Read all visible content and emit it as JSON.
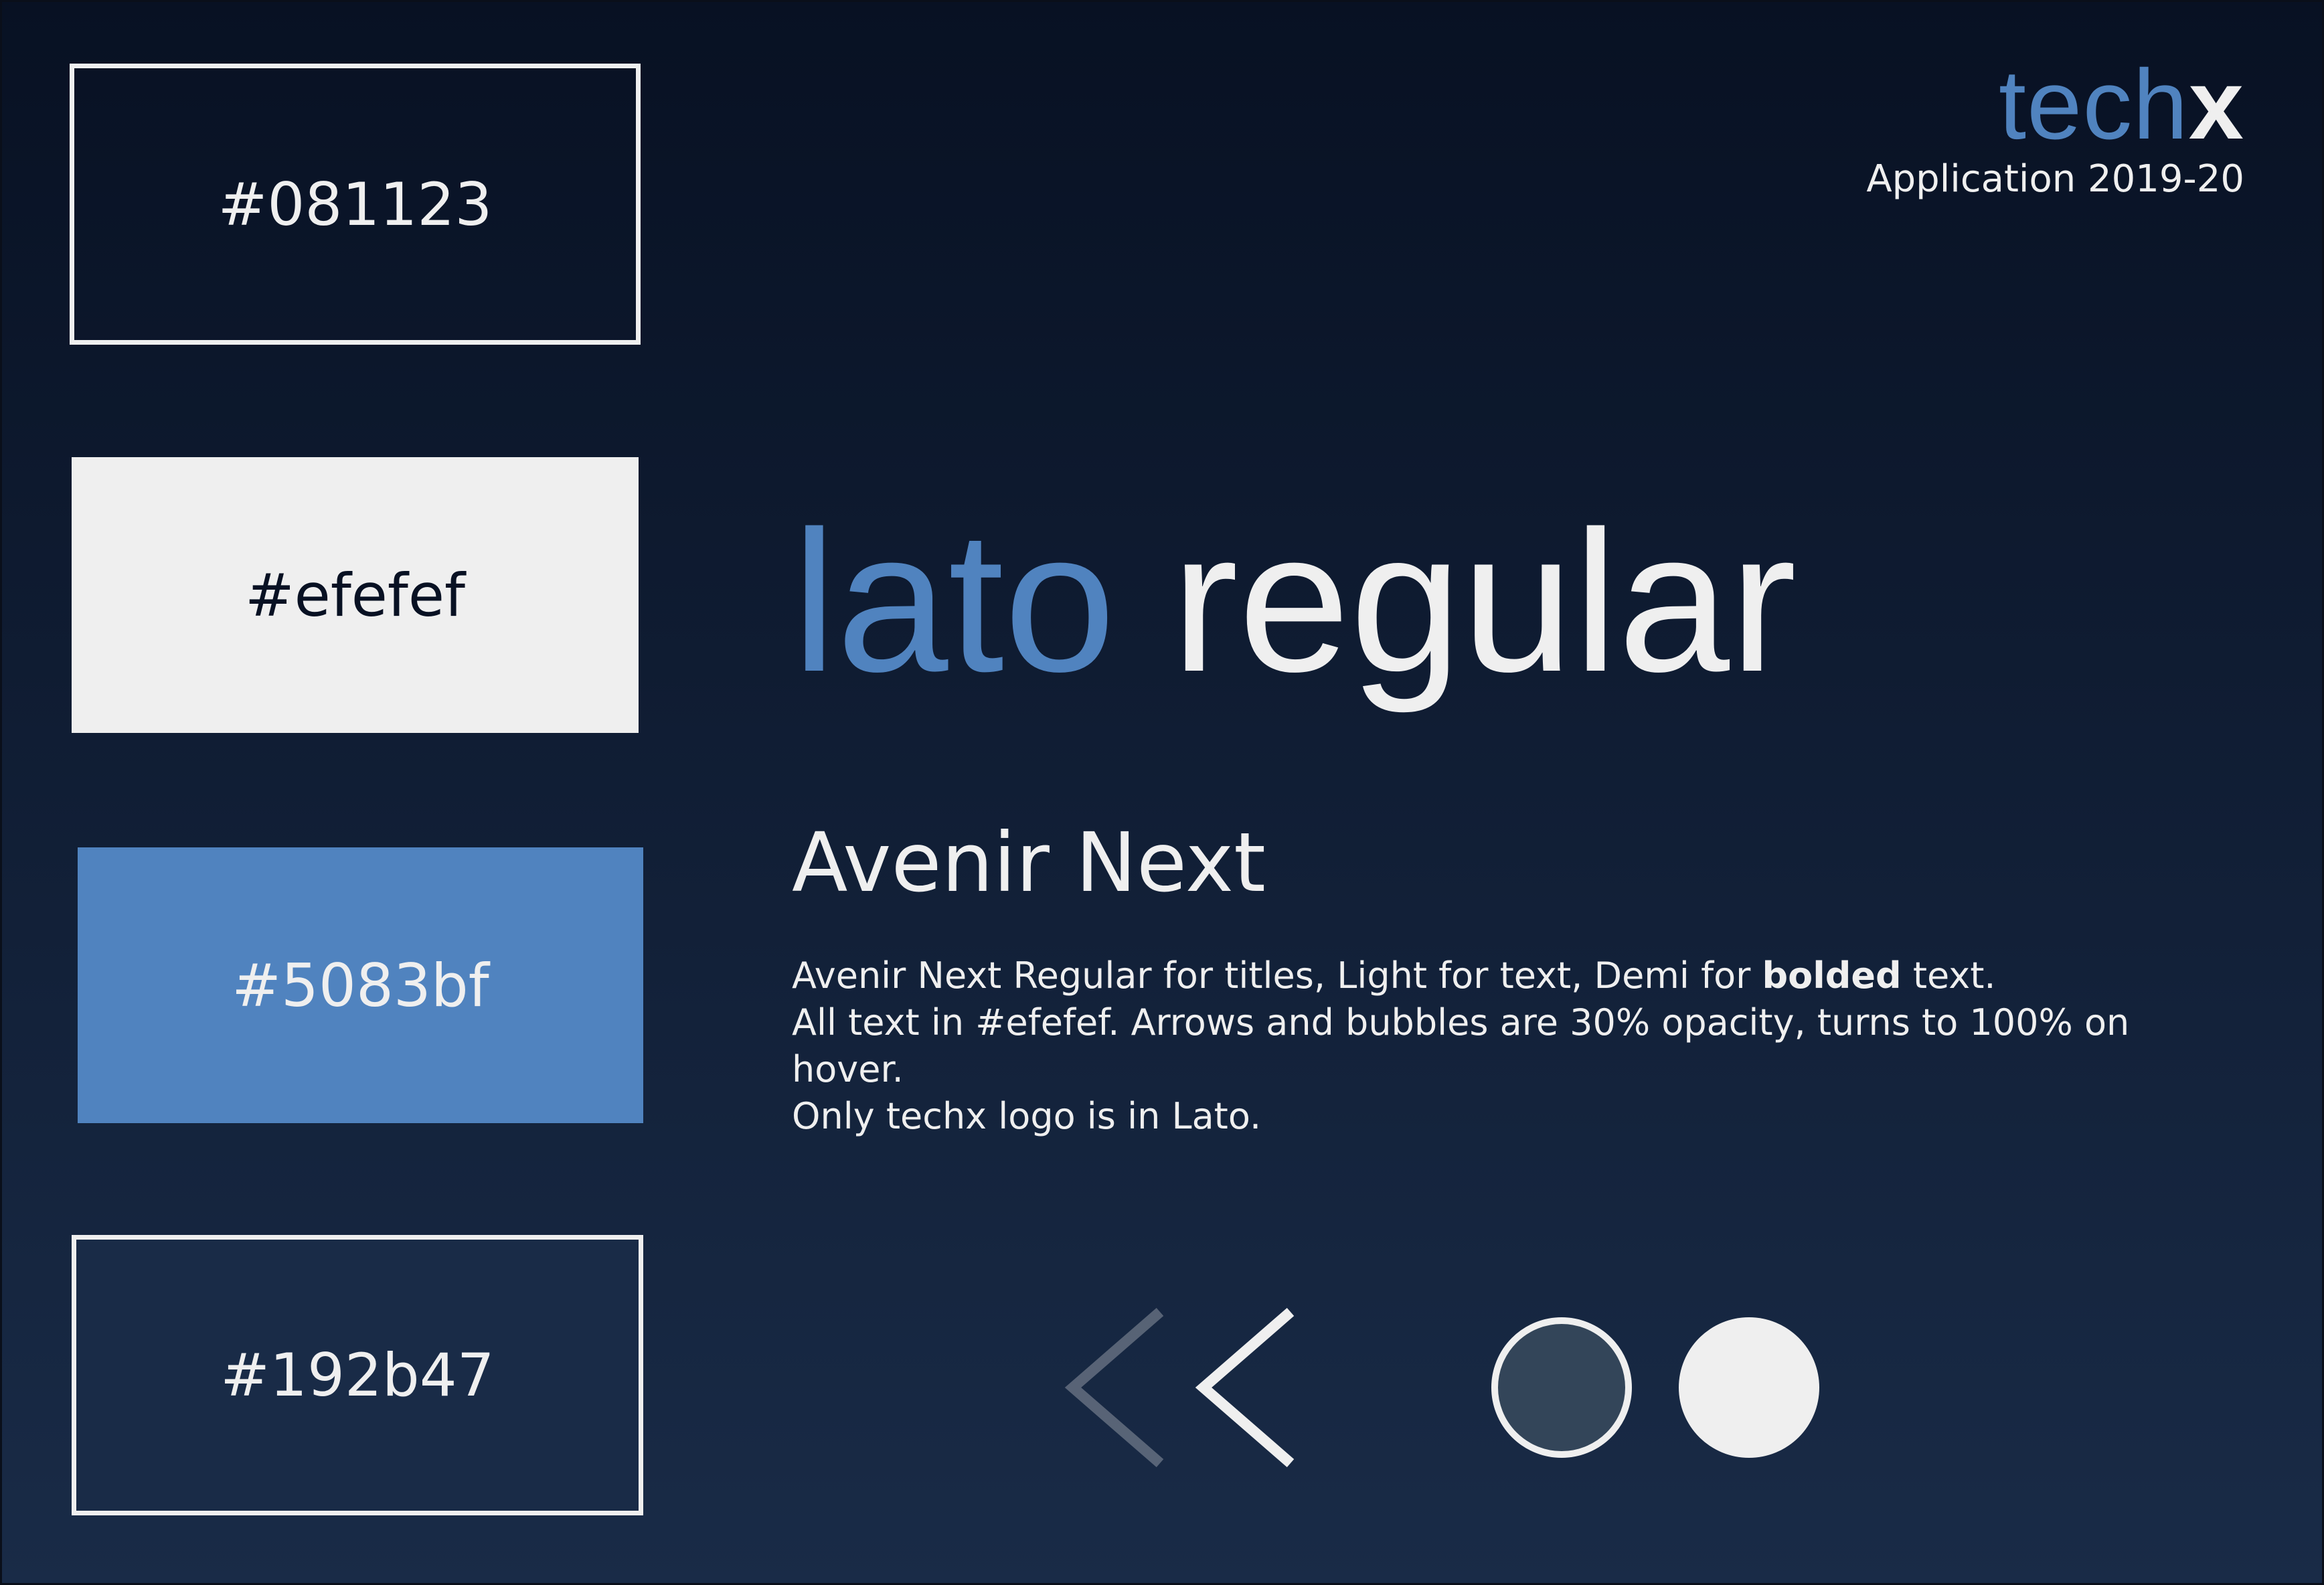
{
  "colors": {
    "background": "#081123",
    "text": "#efefef",
    "accent": "#5083bf",
    "panel": "#192b47",
    "dim_bubble": "#334559"
  },
  "swatches": [
    {
      "label": "#081123",
      "color": "#081123"
    },
    {
      "label": "#efefef",
      "color": "#efefef"
    },
    {
      "label": "#5083bf",
      "color": "#5083bf"
    },
    {
      "label": "#192b47",
      "color": "#192b47"
    }
  ],
  "logo": {
    "tech": "tech",
    "x": "x",
    "subtitle": "Application 2019-20"
  },
  "font_demo": {
    "word_a": "lato",
    "word_b": "regular"
  },
  "subhead": "Avenir Next",
  "description": {
    "line1_before": "Avenir Next Regular for titles, Light for text, Demi for ",
    "line1_bold": "bolded",
    "line1_after": " text.",
    "line2": "All text in #efefef. Arrows and bubbles are 30% opacity, turns to 100% on hover.",
    "line3": "Only techx logo is in Lato."
  },
  "arrows": {
    "icon": "chevron-left-icon",
    "opacities": [
      0.3,
      1.0
    ]
  },
  "bubbles": {
    "icon": "circle-icon",
    "opacities": [
      0.3,
      1.0
    ]
  }
}
